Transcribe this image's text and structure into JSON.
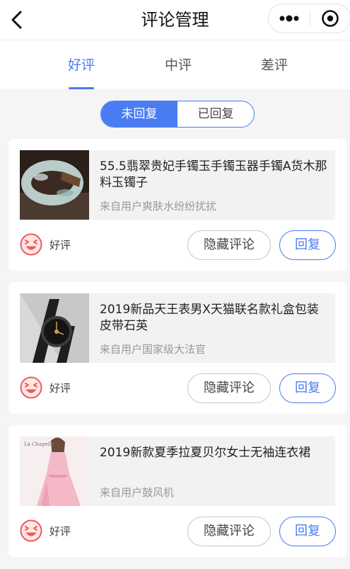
{
  "navbar": {
    "title": "评论管理"
  },
  "tabs": [
    {
      "label": "好评",
      "active": true
    },
    {
      "label": "中评",
      "active": false
    },
    {
      "label": "差评",
      "active": false
    }
  ],
  "segment": {
    "unreplied": "未回复",
    "replied": "已回复",
    "selected": "未回复"
  },
  "comments": [
    {
      "title": "55.5翡翠贵妃手镯玉手镯玉器手镯A货木那料玉镯子",
      "from": "来自用户爽肤水纷纷扰扰",
      "rating": "好评",
      "hide_label": "隐藏评论",
      "reply_label": "回复"
    },
    {
      "title": "2019新品天王表男X天猫联名款礼盒包装皮带石英",
      "from": "来自用户国家级大法官",
      "rating": "好评",
      "hide_label": "隐藏评论",
      "reply_label": "回复"
    },
    {
      "title": "2019新款夏季拉夏贝尔女士无袖连衣裙",
      "from": "来自用户鼓风机",
      "rating": "好评",
      "hide_label": "隐藏评论",
      "reply_label": "回复",
      "image_brand": "La Chapelle"
    }
  ],
  "colors": {
    "accent": "#4a7cf2",
    "rating_icon": "#f05a5a"
  },
  "icons": {
    "back": "back-arrow-icon",
    "more": "more-dots-icon",
    "close": "miniapp-close-icon",
    "rating": "laughing-face-icon"
  }
}
